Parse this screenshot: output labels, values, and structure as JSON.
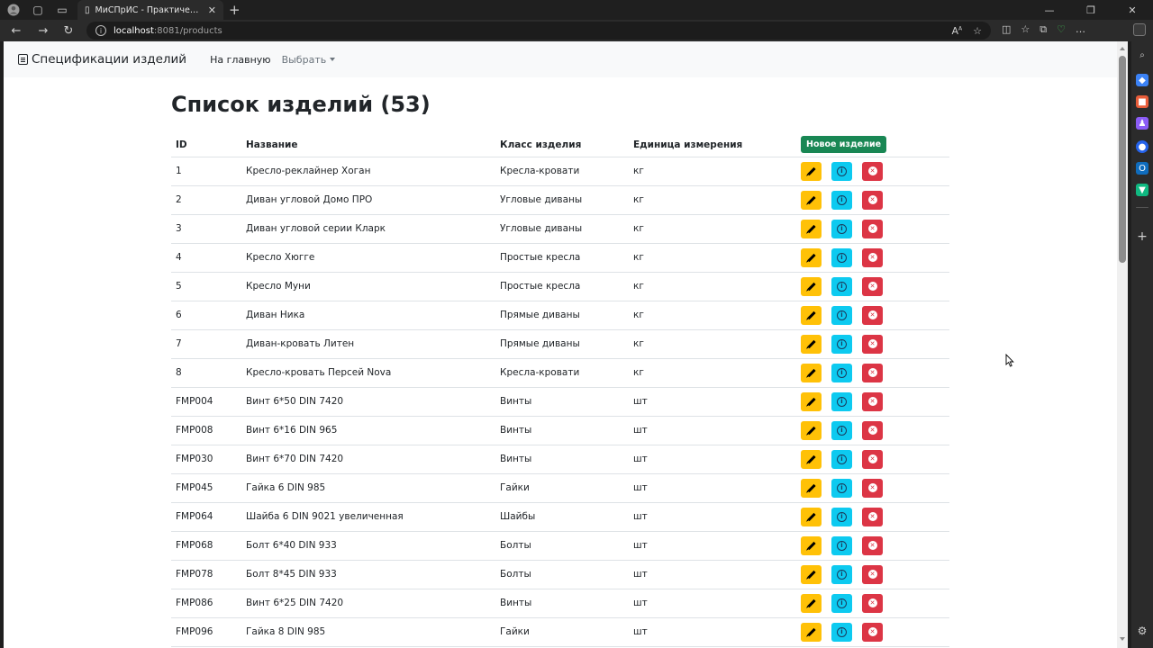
{
  "browser": {
    "tab_title": "МиСПрИС - Практическая рабо",
    "url_host": "localhost",
    "url_rest": ":8081/products"
  },
  "app": {
    "brand": "Спецификации изделий",
    "nav_home": "На главную",
    "nav_select": "Выбрать"
  },
  "page": {
    "title": "Список изделий (53)",
    "columns": [
      "ID",
      "Название",
      "Класс изделия",
      "Единица измерения"
    ],
    "new_button": "Новое изделие"
  },
  "rows": [
    {
      "id": "1",
      "name": "Кресло-реклайнер Хоган",
      "class": "Кресла-кровати",
      "unit": "кг"
    },
    {
      "id": "2",
      "name": "Диван угловой Домо ПРО",
      "class": "Угловые диваны",
      "unit": "кг"
    },
    {
      "id": "3",
      "name": "Диван угловой серии Кларк",
      "class": "Угловые диваны",
      "unit": "кг"
    },
    {
      "id": "4",
      "name": "Кресло Хюгге",
      "class": "Простые кресла",
      "unit": "кг"
    },
    {
      "id": "5",
      "name": "Кресло Муни",
      "class": "Простые кресла",
      "unit": "кг"
    },
    {
      "id": "6",
      "name": "Диван Ника",
      "class": "Прямые диваны",
      "unit": "кг"
    },
    {
      "id": "7",
      "name": "Диван-кровать Литен",
      "class": "Прямые диваны",
      "unit": "кг"
    },
    {
      "id": "8",
      "name": "Кресло-кровать Персей Nova",
      "class": "Кресла-кровати",
      "unit": "кг"
    },
    {
      "id": "FMP004",
      "name": "Винт 6*50 DIN 7420",
      "class": "Винты",
      "unit": "шт"
    },
    {
      "id": "FMP008",
      "name": "Винт 6*16 DIN 965",
      "class": "Винты",
      "unit": "шт"
    },
    {
      "id": "FMP030",
      "name": "Винт 6*70 DIN 7420",
      "class": "Винты",
      "unit": "шт"
    },
    {
      "id": "FMP045",
      "name": "Гайка 6 DIN 985",
      "class": "Гайки",
      "unit": "шт"
    },
    {
      "id": "FMP064",
      "name": "Шайба 6 DIN 9021 увеличенная",
      "class": "Шайбы",
      "unit": "шт"
    },
    {
      "id": "FMP068",
      "name": "Болт 6*40 DIN 933",
      "class": "Болты",
      "unit": "шт"
    },
    {
      "id": "FMP078",
      "name": "Болт 8*45 DIN 933",
      "class": "Болты",
      "unit": "шт"
    },
    {
      "id": "FMP086",
      "name": "Винт 6*25 DIN 7420",
      "class": "Винты",
      "unit": "шт"
    },
    {
      "id": "FMP096",
      "name": "Гайка 8 DIN 985",
      "class": "Гайки",
      "unit": "шт"
    }
  ],
  "icons": {
    "edit": "pencil-icon",
    "info": "info-icon",
    "delete": "x-circle-icon"
  },
  "colors": {
    "edit": "#ffc107",
    "info": "#0dcaf0",
    "delete": "#dc3545",
    "new": "#198754"
  }
}
